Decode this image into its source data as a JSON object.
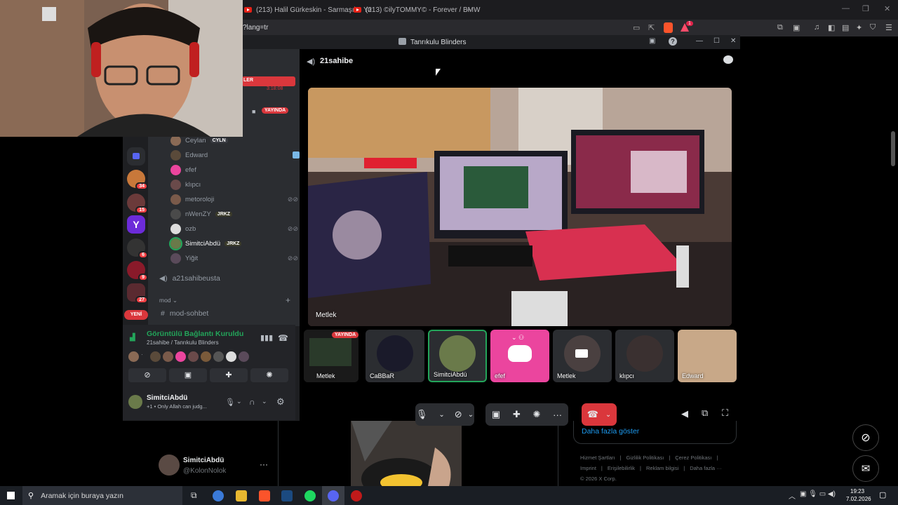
{
  "browser": {
    "tabs": [
      {
        "label": "(213) Halil Gürkeskin - Sarmaşık - Yo"
      },
      {
        "label": "(213) ©ilyTOMMY© - Forever / BMW"
      }
    ],
    "new_tab": "+",
    "url_fragment": "?lang=tr",
    "notif_count": "1"
  },
  "discord": {
    "window_title": "Tanrıkulu Blinders",
    "channel_name": "21sahibe",
    "server_badges": [
      "34",
      "15",
      "6",
      "9",
      "27"
    ],
    "new_label": "YENİ",
    "banner_label": "LER",
    "banner_time": "3:18:08",
    "live_label": "YAYINDA",
    "members": [
      {
        "name": "Ceylan",
        "tag": "CYLN"
      },
      {
        "name": "Edward",
        "tag": ""
      },
      {
        "name": "efef",
        "tag": ""
      },
      {
        "name": "klıpcı",
        "tag": ""
      },
      {
        "name": "metoroloji",
        "tag": ""
      },
      {
        "name": "nWenZY",
        "tag": "JRKZ"
      },
      {
        "name": "ozb",
        "tag": ""
      },
      {
        "name": "SimitciAbdü",
        "tag": "JRKZ"
      },
      {
        "name": "Yiğit",
        "tag": ""
      }
    ],
    "channels": {
      "voice2": "a21sahibeusta",
      "category": "mod",
      "text_channel": "mod-sohbet"
    },
    "voice_panel": {
      "status": "Görüntülü Bağlantı Kuruldu",
      "location": "21sahibe / Tanrıkulu Blinders"
    },
    "user": {
      "name": "SimitciAbdü",
      "status": "+1 • Only Allah can judg..."
    },
    "main_video_label": "Metlek",
    "tiles": [
      {
        "label": "Metlek",
        "live": "YAYINDA"
      },
      {
        "label": "CaBBaR"
      },
      {
        "label": "SimitciAbdü"
      },
      {
        "label": "efef"
      },
      {
        "label": "Metlek"
      },
      {
        "label": "klıpcı"
      },
      {
        "label": "Edward"
      }
    ]
  },
  "page": {
    "show_more": "Daha fazla göster",
    "footer_links": [
      "Hizmet Şartları",
      "Gizlilik Politikası",
      "Çerez Politikası",
      "Imprint",
      "Erişilebilirlik",
      "Reklam bilgisi",
      "Daha fazla ···"
    ],
    "copyright": "© 2026 X Corp.",
    "post_name": "SimitciAbdü",
    "post_handle": "@KolonNolok"
  },
  "taskbar": {
    "search_placeholder": "Aramak için buraya yazın",
    "time": "19:23",
    "date": "7.02.2026"
  },
  "colors": {
    "discord_bg": "#1e1f22",
    "accent_green": "#23a55a",
    "danger_red": "#da373c",
    "blurple": "#5865f2",
    "pink": "#eb459e"
  }
}
